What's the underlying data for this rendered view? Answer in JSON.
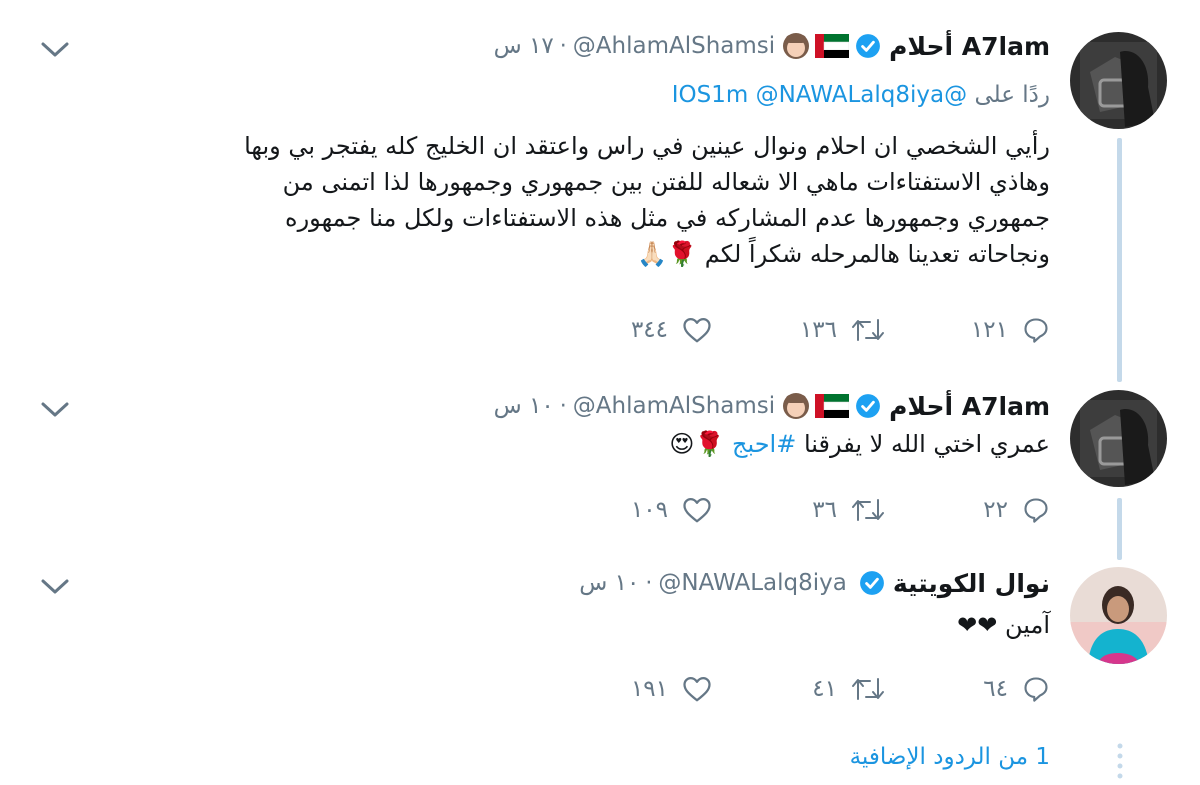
{
  "tweets": [
    {
      "name": "A7lam أحلام",
      "handle": "@AhlamAlShamsi",
      "time": "١٧ س",
      "replying_prefix": "ردًا على",
      "replying_to": [
        "@IOS1m",
        "@NAWALalq8iya"
      ],
      "body_lines": [
        "رأيي الشخصي ان احلام ونوال عينين في راس واعتقد ان الخليج كله يفتجر بي وبها",
        "وهاذي الاستفتاءات ماهي الا شعاله للفتن بين جمهوري وجمهورها لذا اتمنى من",
        "جمهوري وجمهورها عدم المشاركه في مثل هذه الاستفتاءات ولكل منا جمهوره",
        "ونجاحاته تعدينا هالمرحله شكراً لكم 🌹🙏🏻"
      ],
      "replies": "١٢١",
      "retweets": "١٣٦",
      "likes": "٣٤٤"
    },
    {
      "name": "A7lam أحلام",
      "handle": "@AhlamAlShamsi",
      "time": "١٠ س",
      "body_text": "عمري اختي الله لا يفرقنا ",
      "hashtag": "#احبج",
      "body_emoji": " 🌹😍",
      "replies": "٢٢",
      "retweets": "٣٦",
      "likes": "١٠٩"
    },
    {
      "name": "نوال الكويتية",
      "handle": "@NAWALalq8iya",
      "time": "١٠ س",
      "body_text": "آمين ❤❤",
      "replies": "٦٤",
      "retweets": "٤١",
      "likes": "١٩١"
    }
  ],
  "more_replies": "1 من الردود الإضافية",
  "colors": {
    "accent": "#1b95e0",
    "muted": "#657786",
    "thread_line": "#c4d9ea"
  }
}
